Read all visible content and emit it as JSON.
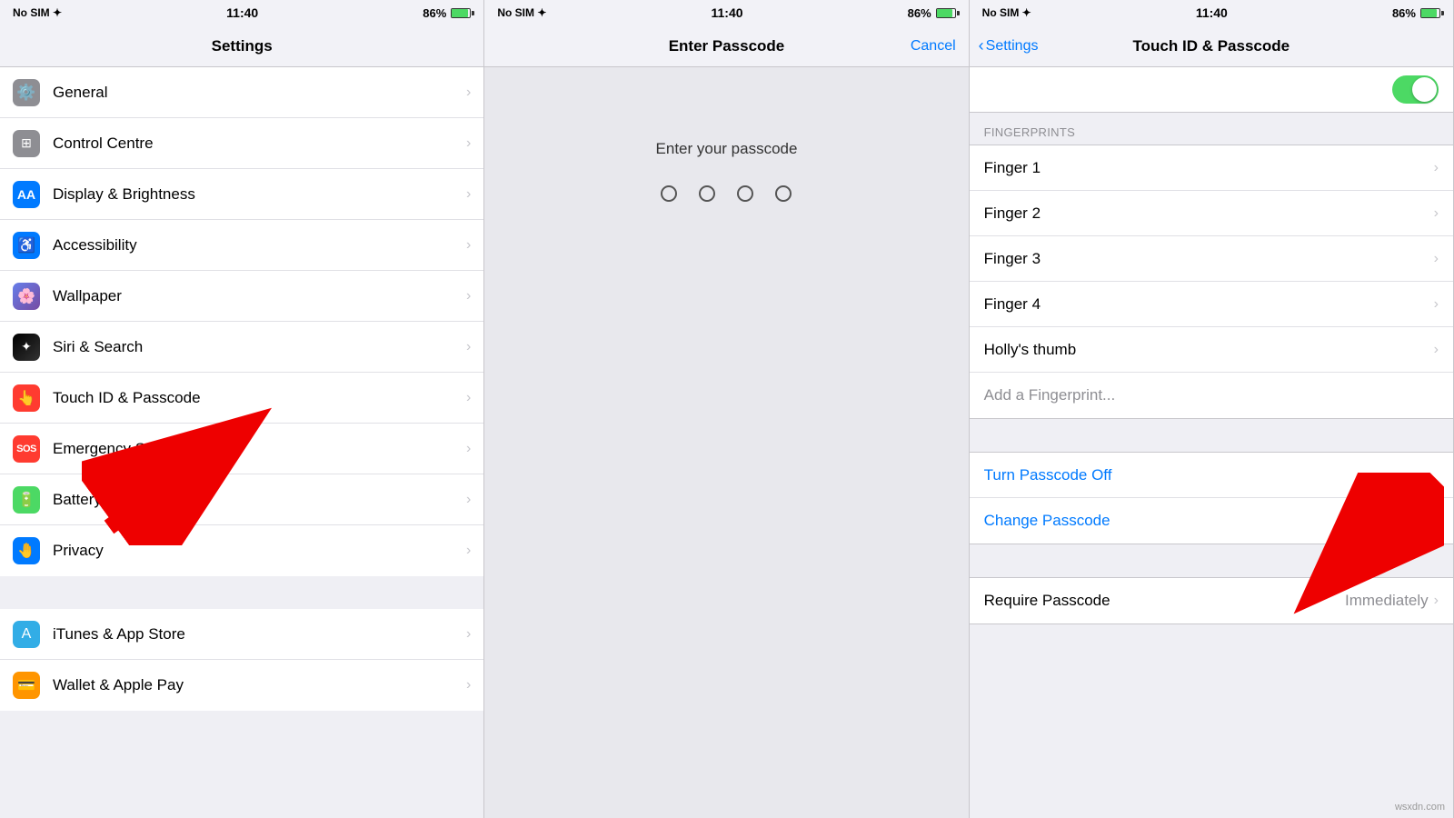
{
  "panels": {
    "panel1": {
      "statusBar": {
        "left": "No SIM ✦",
        "time": "11:40",
        "battery": "86%"
      },
      "navTitle": "Settings",
      "sections": [
        {
          "rows": [
            {
              "icon": "⚙️",
              "iconBg": "icon-gray",
              "label": "General"
            },
            {
              "icon": "🎛️",
              "iconBg": "icon-gray",
              "label": "Control Centre"
            },
            {
              "icon": "AA",
              "iconBg": "icon-blue",
              "label": "Display & Brightness"
            },
            {
              "icon": "♿",
              "iconBg": "icon-blue",
              "label": "Accessibility"
            },
            {
              "icon": "🖼️",
              "iconBg": "icon-wallpaper",
              "label": "Wallpaper"
            },
            {
              "icon": "✦",
              "iconBg": "icon-siri",
              "label": "Siri & Search"
            },
            {
              "icon": "👆",
              "iconBg": "icon-red",
              "label": "Touch ID & Passcode"
            },
            {
              "icon": "SOS",
              "iconBg": "icon-red",
              "label": "Emergency SOS"
            },
            {
              "icon": "🔋",
              "iconBg": "icon-green",
              "label": "Battery"
            },
            {
              "icon": "🤚",
              "iconBg": "icon-blue",
              "label": "Privacy"
            }
          ]
        },
        {
          "rows": [
            {
              "icon": "A",
              "iconBg": "icon-cyan",
              "label": "iTunes & App Store"
            },
            {
              "icon": "💳",
              "iconBg": "icon-orange",
              "label": "Wallet & Apple Pay"
            }
          ]
        }
      ]
    },
    "panel2": {
      "statusBar": {
        "left": "No SIM ✦",
        "time": "11:40",
        "battery": "86%"
      },
      "navTitle": "Enter Passcode",
      "cancelLabel": "Cancel",
      "prompt": "Enter your passcode",
      "dots": 4
    },
    "panel3": {
      "statusBar": {
        "left": "No SIM ✦",
        "time": "11:40",
        "battery": "86%"
      },
      "backLabel": "Settings",
      "navTitle": "Touch ID & Passcode",
      "fingerprintsHeader": "FINGERPRINTS",
      "fingerprints": [
        {
          "label": "Finger 1"
        },
        {
          "label": "Finger 2"
        },
        {
          "label": "Finger 3"
        },
        {
          "label": "Finger 4"
        },
        {
          "label": "Holly's thumb"
        }
      ],
      "addFingerprint": "Add a Fingerprint...",
      "turnPasscodeOff": "Turn Passcode Off",
      "changePasscode": "Change Passcode",
      "requirePasscodeLabel": "Require Passcode",
      "requirePasscodeValue": "Immediately"
    }
  },
  "watermark": "wsxdn.com"
}
